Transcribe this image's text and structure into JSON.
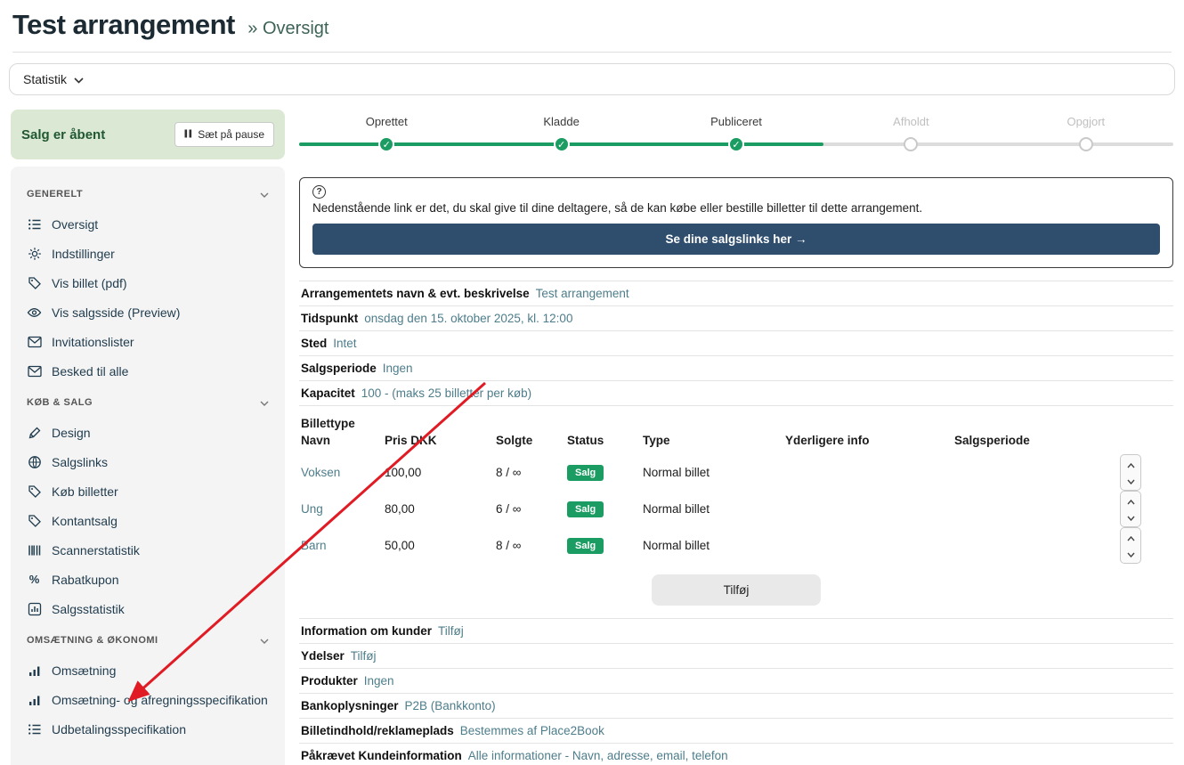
{
  "page": {
    "title": "Test arrangement",
    "breadcrumb_separator": "»",
    "breadcrumb": "Oversigt"
  },
  "statistik_bar": {
    "label": "Statistik"
  },
  "sidebar": {
    "status": {
      "label": "Salg er åbent",
      "pause_button": "Sæt på pause"
    },
    "sections": [
      {
        "title": "GENERELT",
        "items": [
          {
            "label": "Oversigt",
            "icon": "list-icon"
          },
          {
            "label": "Indstillinger",
            "icon": "gear-icon"
          },
          {
            "label": "Vis billet (pdf)",
            "icon": "tag-icon"
          },
          {
            "label": "Vis salgsside (Preview)",
            "icon": "eye-icon"
          },
          {
            "label": "Invitationslister",
            "icon": "envelope-icon"
          },
          {
            "label": "Besked til alle",
            "icon": "envelope-icon"
          }
        ]
      },
      {
        "title": "KØB & SALG",
        "items": [
          {
            "label": "Design",
            "icon": "pen-icon"
          },
          {
            "label": "Salgslinks",
            "icon": "globe-icon"
          },
          {
            "label": "Køb billetter",
            "icon": "tag-icon"
          },
          {
            "label": "Kontantsalg",
            "icon": "tag-icon"
          },
          {
            "label": "Scannerstatistik",
            "icon": "barcode-icon"
          },
          {
            "label": "Rabatkupon",
            "icon": "percent-icon"
          },
          {
            "label": "Salgsstatistik",
            "icon": "stats-icon"
          }
        ]
      },
      {
        "title": "OMSÆTNING & ØKONOMI",
        "items": [
          {
            "label": "Omsætning",
            "icon": "chart-icon"
          },
          {
            "label": "Omsætning- og afregningsspecifikation",
            "icon": "chart-icon"
          },
          {
            "label": "Udbetalingsspecifikation",
            "icon": "list-icon"
          }
        ]
      }
    ]
  },
  "stepper": {
    "steps": [
      {
        "label": "Oprettet",
        "state": "done"
      },
      {
        "label": "Kladde",
        "state": "done"
      },
      {
        "label": "Publiceret",
        "state": "done"
      },
      {
        "label": "Afholdt",
        "state": "todo"
      },
      {
        "label": "Opgjort",
        "state": "todo"
      }
    ]
  },
  "info_box": {
    "text": "Nedenstående link er det, du skal give til dine deltagere, så de kan købe eller bestille billetter til dette arrangement.",
    "button": "Se dine salgslinks her →"
  },
  "details_top": [
    {
      "label": "Arrangementets navn & evt. beskrivelse",
      "value": "Test arrangement"
    },
    {
      "label": "Tidspunkt",
      "value": "onsdag den 15. oktober 2025, kl. 12:00"
    },
    {
      "label": "Sted",
      "value": "Intet"
    },
    {
      "label": "Salgsperiode",
      "value": "Ingen"
    },
    {
      "label": "Kapacitet",
      "value": "100 - (maks 25 billetter per køb)"
    }
  ],
  "tickets": {
    "section_title": "Billettype",
    "columns": [
      "Navn",
      "Pris DKK",
      "Solgte",
      "Status",
      "Type",
      "Yderligere info",
      "Salgsperiode"
    ],
    "rows": [
      {
        "name": "Voksen",
        "price": "100,00",
        "sold": "8 / ∞",
        "status": "Salg",
        "type": "Normal billet"
      },
      {
        "name": "Ung",
        "price": "80,00",
        "sold": "6 / ∞",
        "status": "Salg",
        "type": "Normal billet"
      },
      {
        "name": "Barn",
        "price": "50,00",
        "sold": "8 / ∞",
        "status": "Salg",
        "type": "Normal billet"
      }
    ],
    "add_button": "Tilføj"
  },
  "details_bottom": [
    {
      "label": "Information om kunder",
      "value": "Tilføj"
    },
    {
      "label": "Ydelser",
      "value": "Tilføj"
    },
    {
      "label": "Produkter",
      "value": "Ingen"
    },
    {
      "label": "Bankoplysninger",
      "value": "P2B (Bankkonto)"
    },
    {
      "label": "Billetindhold/reklameplads",
      "value": "Bestemmes af Place2Book"
    },
    {
      "label": "Påkrævet Kundeinformation",
      "value": "Alle informationer - Navn, adresse, email, telefon"
    }
  ],
  "colors": {
    "accent_green": "#1a9c62",
    "navy_button": "#2f4e6e",
    "status_banner_bg": "#dbe8d4",
    "status_banner_text": "#215732",
    "value_teal": "#4d7d8b",
    "arrow_red": "#e01b24"
  }
}
